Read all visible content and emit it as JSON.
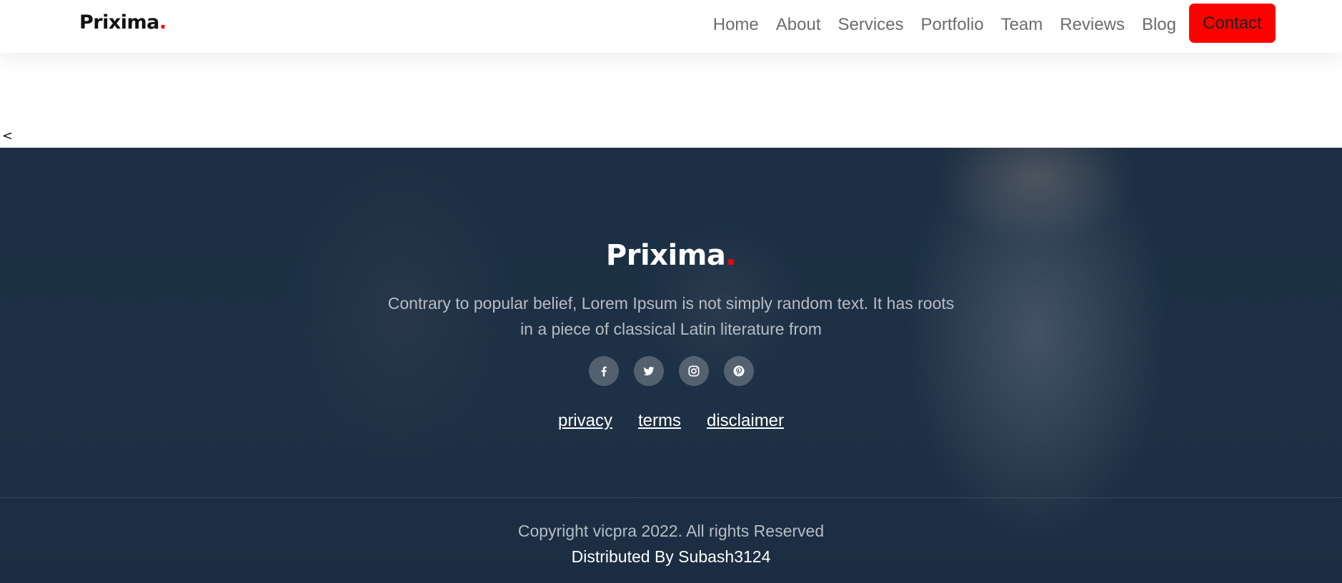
{
  "navbar": {
    "brand": {
      "name": "Prixima",
      "dot": "."
    },
    "links": [
      {
        "label": "Home"
      },
      {
        "label": "About"
      },
      {
        "label": "Services"
      },
      {
        "label": "Portfolio"
      },
      {
        "label": "Team"
      },
      {
        "label": "Reviews"
      },
      {
        "label": "Blog"
      }
    ],
    "contact_label": "Contact"
  },
  "stray_text": "<",
  "footer": {
    "brand": {
      "name": "Prixima",
      "dot": "."
    },
    "description": "Contrary to popular belief, Lorem Ipsum is not simply random text. It has roots in a piece of classical Latin literature from",
    "socials": [
      {
        "icon": "facebook-icon"
      },
      {
        "icon": "twitter-icon"
      },
      {
        "icon": "instagram-icon"
      },
      {
        "icon": "pinterest-icon"
      }
    ],
    "legal_links": [
      {
        "label": "privacy"
      },
      {
        "label": "terms"
      },
      {
        "label": "disclaimer"
      }
    ],
    "copyright": "Copyright vicpra 2022. All rights Reserved",
    "distributed": "Distributed By Subash3124"
  },
  "colors": {
    "accent": "#ff0000",
    "footer_bg": "#1c2f44"
  }
}
